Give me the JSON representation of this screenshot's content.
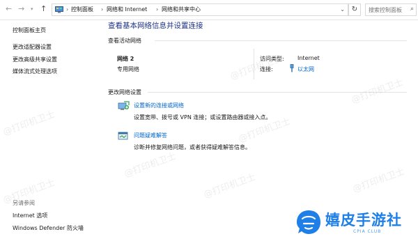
{
  "address_bar": {
    "breadcrumbs": [
      "控制面板",
      "网络和 Internet",
      "网络和共享中心"
    ],
    "search_placeholder": "搜索控制面板"
  },
  "left_pane": {
    "links": [
      "控制面板主页",
      "更改适配器设置",
      "更改高级共享设置",
      "媒体流式处理选项"
    ],
    "see_also_title": "另请参阅",
    "see_also": [
      "Internet 选项",
      "Windows Defender 防火墙"
    ]
  },
  "main": {
    "title": "查看基本网络信息并设置连接",
    "active_networks_title": "查看活动网络",
    "network": {
      "name": "网络 2",
      "type": "专用网络",
      "access_type_label": "访问类型:",
      "access_type_value": "Internet",
      "connections_label": "连接:",
      "connection_value": "以太网"
    },
    "change_settings_title": "更改网络设置",
    "tasks": [
      {
        "link": "设置新的连接或网络",
        "desc": "设置宽带、拨号或 VPN 连接；或设置路由器或接入点。"
      },
      {
        "link": "问题疑难解答",
        "desc": "诊断并修复网络问题，或者获得疑难解答信息。"
      }
    ]
  },
  "watermark_text": "@打印机卫士",
  "brand": {
    "name": "嬉皮手游社",
    "subtitle": "CPIA CLUB"
  },
  "colors": {
    "link": "#0066cc",
    "title": "#1e3287",
    "brand": "#1e7fe8"
  }
}
